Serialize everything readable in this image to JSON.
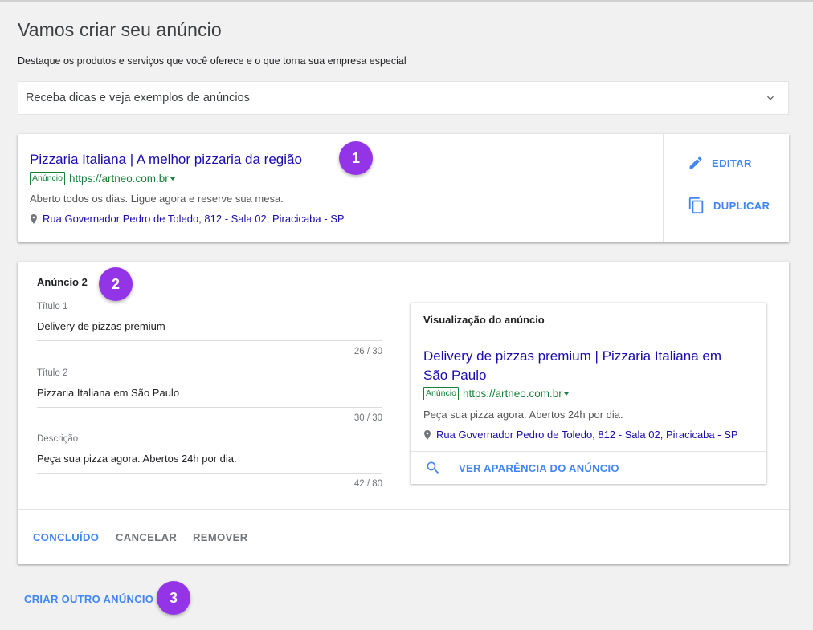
{
  "page": {
    "title": "Vamos criar seu anúncio",
    "subtitle": "Destaque os produtos e serviços que você oferece e o que torna sua empresa especial"
  },
  "tips": {
    "label": "Receba dicas e veja exemplos de anúncios",
    "icon": "chevron-down-icon"
  },
  "ad1": {
    "headline": "Pizzaria Italiana | A melhor pizzaria da região",
    "badge": "Anúncio",
    "url": "https://artneo.com.br",
    "description": "Aberto todos os dias. Ligue agora e reserve sua mesa.",
    "address": "Rua Governador Pedro de Toledo, 812 - Sala 02, Piracicaba - SP",
    "actions": {
      "edit": "EDITAR",
      "duplicate": "DUPLICAR"
    }
  },
  "steps": [
    "1",
    "2",
    "3"
  ],
  "ad2": {
    "title": "Anúncio 2",
    "fields": [
      {
        "label": "Título 1",
        "value": "Delivery de pizzas premium",
        "counter": "26 / 30"
      },
      {
        "label": "Título 2",
        "value": "Pizzaria Italiana em São Paulo",
        "counter": "30 / 30"
      },
      {
        "label": "Descrição",
        "value": "Peça sua pizza agora. Abertos 24h por dia.",
        "counter": "42 / 80"
      }
    ],
    "preview": {
      "heading": "Visualização do anúncio",
      "headline": "Delivery de pizzas premium | Pizzaria Italiana em São Paulo",
      "badge": "Anúncio",
      "url": "https://artneo.com.br",
      "description": "Peça sua pizza agora. Abertos 24h por dia.",
      "address": "Rua Governador Pedro de Toledo, 812 - Sala 02, Piracicaba - SP",
      "view_label": "VER APARÊNCIA DO ANÚNCIO"
    },
    "buttons": {
      "done": "CONCLUÍDO",
      "cancel": "CANCELAR",
      "remove": "REMOVER"
    }
  },
  "create_another": "CRIAR OUTRO ANÚNCIO",
  "colors": {
    "accent": "#4285f4",
    "step_badge": "#9334e6",
    "ad_link": "#1a0dab",
    "ad_url": "#188038"
  }
}
